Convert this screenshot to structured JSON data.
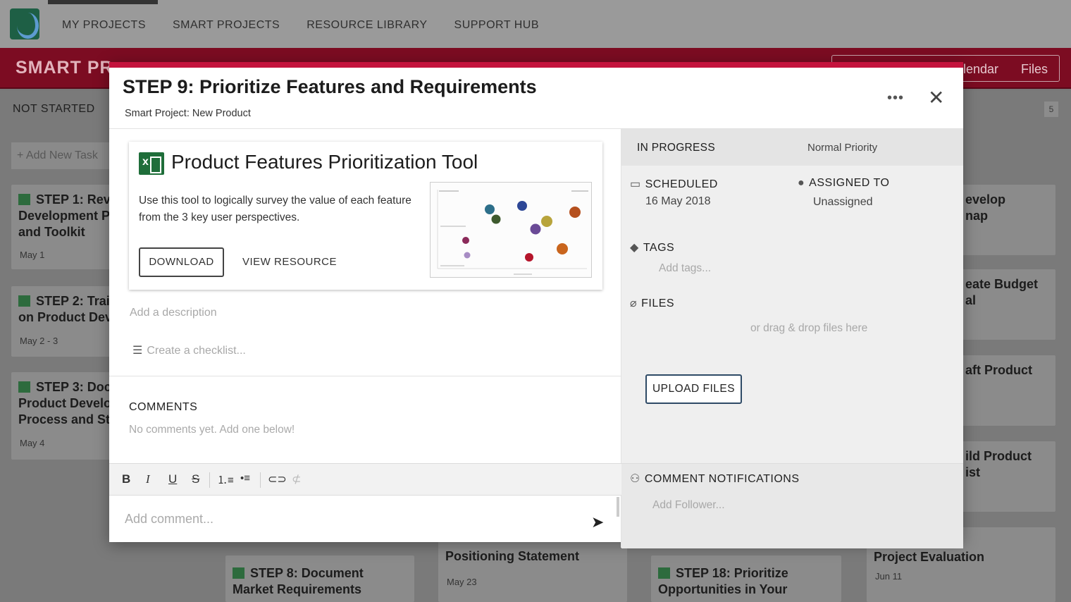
{
  "nav": {
    "items": [
      "MY PROJECTS",
      "SMART PROJECTS",
      "RESOURCE LIBRARY",
      "SUPPORT HUB"
    ]
  },
  "banner": {
    "title": "SMART PR",
    "buttons": [
      "lendar",
      "Files"
    ]
  },
  "board": {
    "column_label": "NOT STARTED",
    "column_count": "5",
    "add_task": "+ Add New Task",
    "cards_left": [
      {
        "title": "STEP 1: Rev\nDevelopment P\nand Toolkit",
        "date": "May 1"
      },
      {
        "title": "STEP 2: Trai\non Product Dev",
        "date": "May 2 - 3"
      },
      {
        "title": "STEP 3: Doc\nProduct Develo\nProcess and St",
        "date": "May 4"
      }
    ],
    "cards_right": [
      {
        "title": "evelop\nnap"
      },
      {
        "title": "eate Budget\nal"
      },
      {
        "title": "aft Product"
      },
      {
        "title": "ild Product\nist"
      },
      {
        "title": "onduct Post\nProject Evaluation",
        "date": "Jun 11"
      }
    ],
    "cards_bottom": [
      {
        "title": "STEP 8: Document\nMarket Requirements"
      },
      {
        "title": "Positioning Statement",
        "date": "May 23"
      },
      {
        "title": "STEP 18: Prioritize\nOpportunities in Your"
      }
    ]
  },
  "modal": {
    "title": "STEP 9: Prioritize Features and Requirements",
    "subtitle": "Smart Project: New Product",
    "more": "•••",
    "close": "✕",
    "resource": {
      "title": "Product Features Prioritization Tool",
      "description": "Use this tool to logically survey the value of each feature from the 3 key user perspectives.",
      "download": "DOWNLOAD",
      "view": "VIEW RESOURCE"
    },
    "description_placeholder": "Add a description",
    "checklist_placeholder": "Create a checklist...",
    "comments_heading": "COMMENTS",
    "comments_empty": "No comments yet. Add one below!",
    "toolbar": {
      "bold": "B",
      "italic": "I",
      "underline": "U",
      "strike": "S"
    },
    "comment_placeholder": "Add comment...",
    "status": "IN PROGRESS",
    "priority": "Normal Priority",
    "scheduled_label": "SCHEDULED",
    "scheduled_value": "16 May 2018",
    "assigned_label": "ASSIGNED TO",
    "assigned_value": "Unassigned",
    "tags_label": "TAGS",
    "tags_placeholder": "Add tags...",
    "files_label": "FILES",
    "upload_button": "UPLOAD FILES",
    "drag_hint": "or drag & drop files here",
    "notifications_label": "COMMENT NOTIFICATIONS",
    "follower_placeholder": "Add Follower..."
  }
}
